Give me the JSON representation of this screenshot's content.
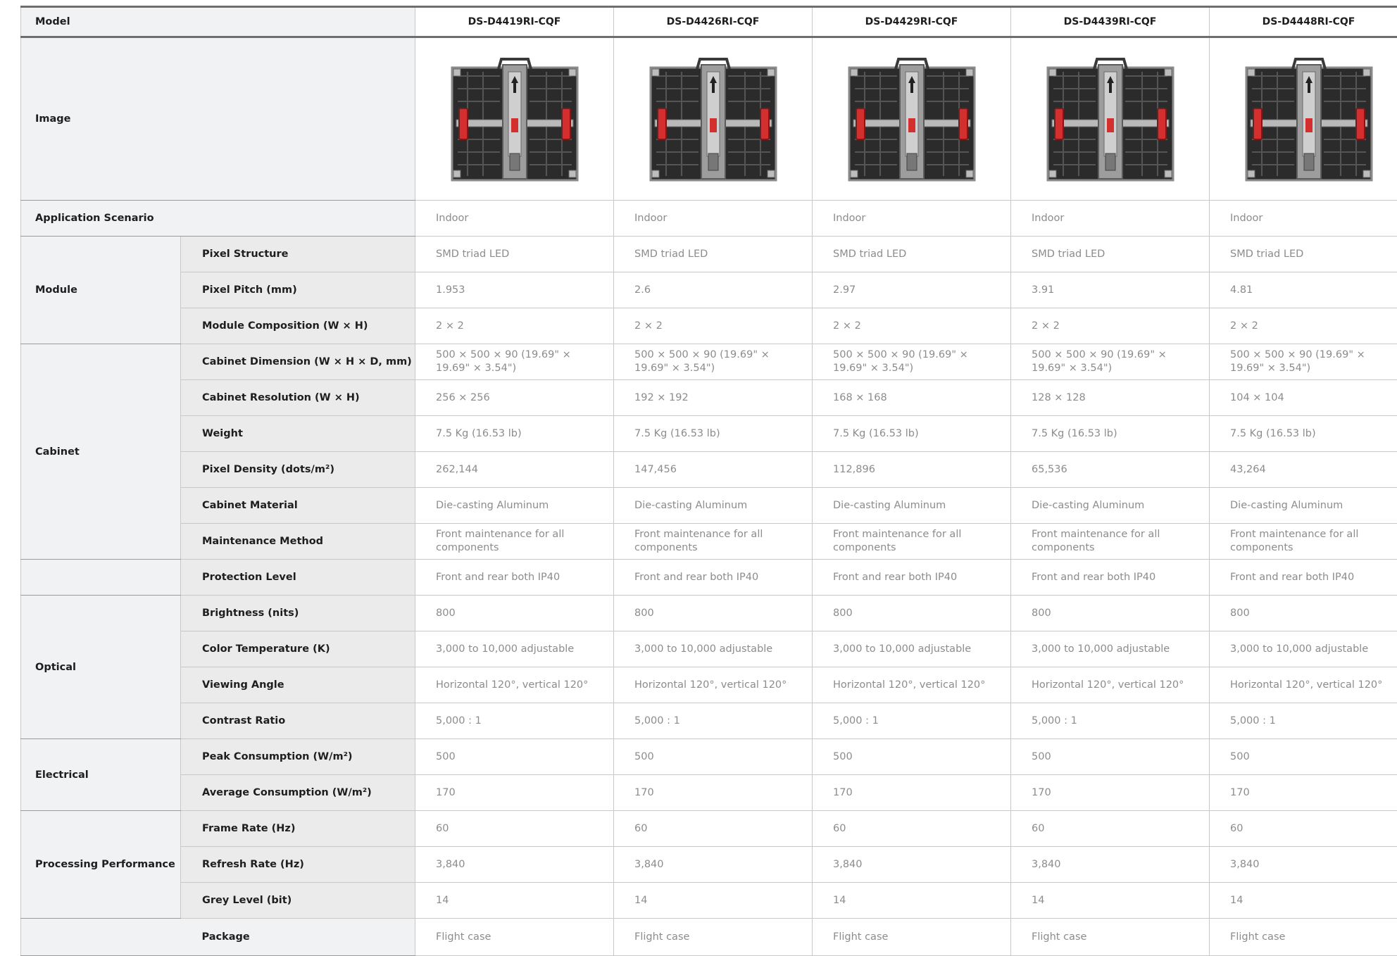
{
  "table": {
    "header_label": "Model",
    "models": [
      "DS-D4419RI-CQF",
      "DS-D4426RI-CQF",
      "DS-D4429RI-CQF",
      "DS-D4439RI-CQF",
      "DS-D4448RI-CQF"
    ],
    "image_label": "Image",
    "image_icon": "led-cabinet-image",
    "application": {
      "label": "Application Scenario",
      "values": [
        "Indoor",
        "Indoor",
        "Indoor",
        "Indoor",
        "Indoor"
      ]
    },
    "module": {
      "label": "Module",
      "rows": [
        {
          "label": "Pixel Structure",
          "values": [
            "SMD triad LED",
            "SMD triad LED",
            "SMD triad LED",
            "SMD triad LED",
            "SMD triad LED"
          ]
        },
        {
          "label": "Pixel Pitch (mm)",
          "values": [
            "1.953",
            "2.6",
            "2.97",
            "3.91",
            "4.81"
          ]
        },
        {
          "label": "Module Composition (W × H)",
          "values": [
            "2 × 2",
            "2 × 2",
            "2 × 2",
            "2 × 2",
            "2 × 2"
          ]
        }
      ]
    },
    "cabinet": {
      "label": "Cabinet",
      "rows": [
        {
          "label": "Cabinet Dimension (W × H × D, mm)",
          "values": [
            "500 × 500 × 90 (19.69\" × 19.69\" × 3.54\")",
            "500 × 500 × 90 (19.69\" × 19.69\" × 3.54\")",
            "500 × 500 × 90 (19.69\" × 19.69\" × 3.54\")",
            "500 × 500 × 90 (19.69\" × 19.69\" × 3.54\")",
            "500 × 500 × 90 (19.69\" × 19.69\" × 3.54\")"
          ]
        },
        {
          "label": "Cabinet Resolution (W × H)",
          "values": [
            "256 × 256",
            "192 × 192",
            "168 × 168",
            "128 × 128",
            "104 × 104"
          ]
        },
        {
          "label": "Weight",
          "values": [
            "7.5 Kg (16.53 lb)",
            "7.5 Kg (16.53 lb)",
            "7.5 Kg (16.53 lb)",
            "7.5 Kg (16.53 lb)",
            "7.5 Kg (16.53 lb)"
          ]
        },
        {
          "label": "Pixel Density (dots/m²)",
          "values": [
            "262,144",
            "147,456",
            "112,896",
            "65,536",
            "43,264"
          ]
        },
        {
          "label": "Cabinet Material",
          "values": [
            "Die-casting Aluminum",
            "Die-casting Aluminum",
            "Die-casting Aluminum",
            "Die-casting Aluminum",
            "Die-casting Aluminum"
          ]
        },
        {
          "label": "Maintenance Method",
          "values": [
            "Front maintenance for all components",
            "Front maintenance for all components",
            "Front maintenance for all components",
            "Front maintenance for all components",
            "Front maintenance for all components"
          ]
        }
      ]
    },
    "protection": {
      "label": "Protection Level",
      "values": [
        "Front and rear both IP40",
        "Front and rear both IP40",
        "Front and rear both IP40",
        "Front and rear both IP40",
        "Front and rear both IP40"
      ]
    },
    "optical": {
      "label": "Optical",
      "rows": [
        {
          "label": "Brightness (nits)",
          "values": [
            "800",
            "800",
            "800",
            "800",
            "800"
          ]
        },
        {
          "label": "Color Temperature (K)",
          "values": [
            "3,000 to 10,000 adjustable",
            "3,000 to 10,000 adjustable",
            "3,000 to 10,000 adjustable",
            "3,000 to 10,000 adjustable",
            "3,000 to 10,000 adjustable"
          ]
        },
        {
          "label": "Viewing Angle",
          "values": [
            "Horizontal 120°, vertical 120°",
            "Horizontal 120°, vertical 120°",
            "Horizontal 120°, vertical 120°",
            "Horizontal 120°, vertical 120°",
            "Horizontal 120°, vertical 120°"
          ]
        },
        {
          "label": "Contrast Ratio",
          "values": [
            "5,000 : 1",
            "5,000 : 1",
            "5,000 : 1",
            "5,000 : 1",
            "5,000 : 1"
          ]
        }
      ]
    },
    "electrical": {
      "label": "Electrical",
      "rows": [
        {
          "label": "Peak Consumption (W/m²)",
          "values": [
            "500",
            "500",
            "500",
            "500",
            "500"
          ]
        },
        {
          "label": "Average Consumption (W/m²)",
          "values": [
            "170",
            "170",
            "170",
            "170",
            "170"
          ]
        }
      ]
    },
    "processing": {
      "label": "Processing Performance",
      "rows": [
        {
          "label": "Frame Rate (Hz)",
          "values": [
            "60",
            "60",
            "60",
            "60",
            "60"
          ]
        },
        {
          "label": "Refresh Rate (Hz)",
          "values": [
            "3,840",
            "3,840",
            "3,840",
            "3,840",
            "3,840"
          ]
        },
        {
          "label": "Grey Level (bit)",
          "values": [
            "14",
            "14",
            "14",
            "14",
            "14"
          ]
        }
      ]
    },
    "package": {
      "label": "Package",
      "values": [
        "Flight case",
        "Flight case",
        "Flight case",
        "Flight case",
        "Flight case"
      ]
    }
  }
}
